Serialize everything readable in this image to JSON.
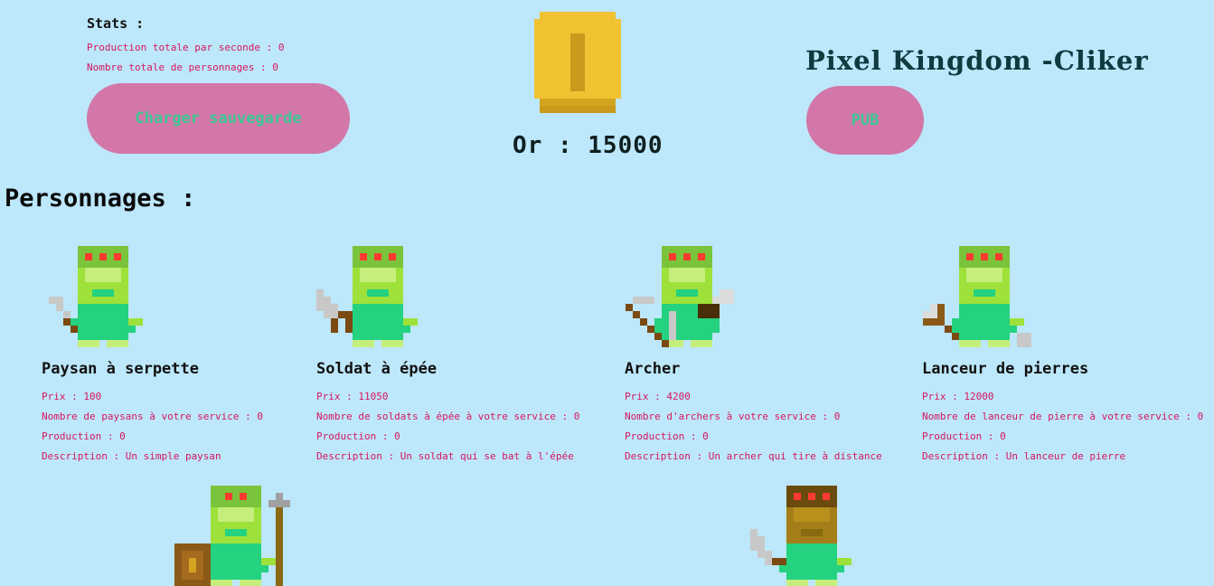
{
  "stats": {
    "title": "Stats :",
    "production_label": "Production totale par seconde : 0",
    "characters_label": "Nombre totale de personnages : 0"
  },
  "buttons": {
    "load_save": "Charger sauvegarde",
    "pub": "PUB"
  },
  "gold": {
    "label": "Or : 15000",
    "icon": "gold-coin-icon",
    "color": "#f1c232"
  },
  "game_title": "Pixel Kingdom -Cliker",
  "section_title": "Personnages :",
  "characters": [
    {
      "name": "Paysan à serpette",
      "price": "Prix : 100",
      "count": "Nombre de paysans à votre service : 0",
      "production": "Production : 0",
      "description": "Description : Un simple paysan",
      "icon": "peasant-sickle-icon"
    },
    {
      "name": "Soldat à épée",
      "price": "Prix : 11050",
      "count": "Nombre de soldats à épée à votre service : 0",
      "production": "Production : 0",
      "description": "Description : Un soldat qui se bat à l'épée",
      "icon": "soldier-sword-icon"
    },
    {
      "name": "Archer",
      "price": "Prix : 4200",
      "count": "Nombre d'archers à votre service : 0",
      "production": "Production : 0",
      "description": "Description : Un archer qui tire à distance",
      "icon": "archer-bow-icon"
    },
    {
      "name": "Lanceur de pierres",
      "price": "Prix : 12000",
      "count": "Nombre de lanceur de pierre à votre service : 0",
      "production": "Production : 0",
      "description": "Description : Un lanceur de pierre",
      "icon": "stone-thrower-icon"
    }
  ],
  "more_characters": [
    {
      "icon": "spearman-shield-icon"
    },
    {
      "icon": "armored-knight-icon"
    }
  ],
  "colors": {
    "background": "#bde7fa",
    "button": "#d277a8",
    "button_text": "#3ec995",
    "stat_text": "#d6165f",
    "goblin_body": "#24d27f",
    "goblin_head": "#9ee13a",
    "eyes": "#ff3b30"
  }
}
